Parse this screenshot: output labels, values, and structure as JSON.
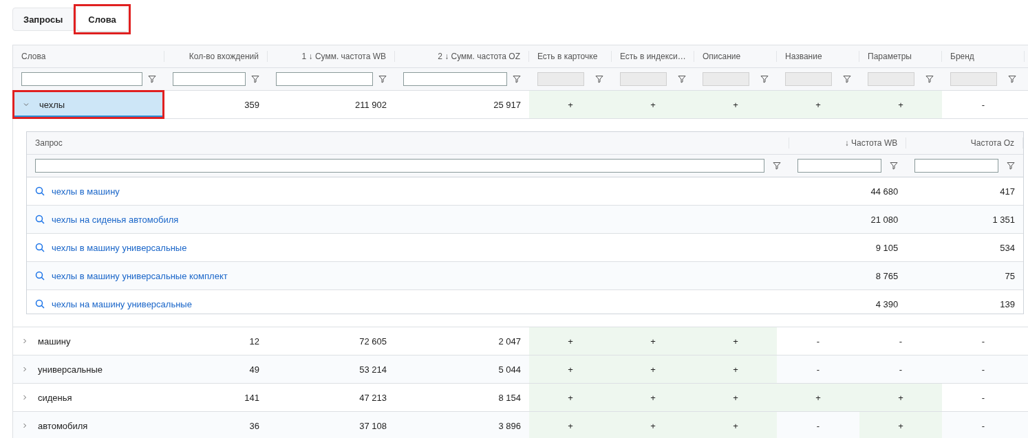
{
  "tabs": [
    {
      "label": "Запросы",
      "selected": false,
      "highlighted": false
    },
    {
      "label": "Слова",
      "selected": true,
      "highlighted": true
    }
  ],
  "table": {
    "columns": [
      {
        "label": "Слова",
        "filter_disabled": false
      },
      {
        "label": "Кол-во вхождений",
        "filter_disabled": false
      },
      {
        "label": "1 ↓ Сумм. частота WB",
        "filter_disabled": false
      },
      {
        "label": "2 ↓ Сумм. частота OZ",
        "filter_disabled": false
      },
      {
        "label": "Есть в карточке",
        "filter_disabled": true
      },
      {
        "label": "Есть в индекси…",
        "filter_disabled": true
      },
      {
        "label": "Описание",
        "filter_disabled": true
      },
      {
        "label": "Название",
        "filter_disabled": true
      },
      {
        "label": "Параметры",
        "filter_disabled": true
      },
      {
        "label": "Бренд",
        "filter_disabled": true
      }
    ],
    "rows": [
      {
        "word": "чехлы",
        "count": "359",
        "wb": "211 902",
        "oz": "25 917",
        "selected": true,
        "highlighted": true,
        "expanded": true,
        "flags": [
          {
            "text": "+",
            "present": true
          },
          {
            "text": "+",
            "present": true
          },
          {
            "text": "+",
            "present": true
          },
          {
            "text": "+",
            "present": true
          },
          {
            "text": "+",
            "present": true
          },
          {
            "text": "-",
            "present": false
          }
        ],
        "detail": {
          "columns": [
            {
              "label": "Запрос"
            },
            {
              "label": "↓ Частота WB"
            },
            {
              "label": "Частота Oz"
            }
          ],
          "rows": [
            {
              "query": "чехлы в машину",
              "wb": "44 680",
              "oz": "417"
            },
            {
              "query": "чехлы на сиденья автомобиля",
              "wb": "21 080",
              "oz": "1 351"
            },
            {
              "query": "чехлы в машину универсальные",
              "wb": "9 105",
              "oz": "534"
            },
            {
              "query": "чехлы в машину универсальные комплект",
              "wb": "8 765",
              "oz": "75"
            },
            {
              "query": "чехлы на машину универсальные",
              "wb": "4 390",
              "oz": "139"
            }
          ]
        }
      },
      {
        "word": "машину",
        "count": "12",
        "wb": "72 605",
        "oz": "2 047",
        "selected": false,
        "highlighted": false,
        "expanded": false,
        "flags": [
          {
            "text": "+",
            "present": true
          },
          {
            "text": "+",
            "present": true
          },
          {
            "text": "+",
            "present": true
          },
          {
            "text": "-",
            "present": false
          },
          {
            "text": "-",
            "present": false
          },
          {
            "text": "-",
            "present": false
          }
        ]
      },
      {
        "word": "универсальные",
        "count": "49",
        "wb": "53 214",
        "oz": "5 044",
        "selected": false,
        "highlighted": false,
        "expanded": false,
        "flags": [
          {
            "text": "+",
            "present": true
          },
          {
            "text": "+",
            "present": true
          },
          {
            "text": "+",
            "present": true
          },
          {
            "text": "-",
            "present": false
          },
          {
            "text": "-",
            "present": false
          },
          {
            "text": "-",
            "present": false
          }
        ]
      },
      {
        "word": "сиденья",
        "count": "141",
        "wb": "47 213",
        "oz": "8 154",
        "selected": false,
        "highlighted": false,
        "expanded": false,
        "flags": [
          {
            "text": "+",
            "present": true
          },
          {
            "text": "+",
            "present": true
          },
          {
            "text": "+",
            "present": true
          },
          {
            "text": "+",
            "present": true
          },
          {
            "text": "+",
            "present": true
          },
          {
            "text": "-",
            "present": false
          }
        ]
      },
      {
        "word": "автомобиля",
        "count": "36",
        "wb": "37 108",
        "oz": "3 896",
        "selected": false,
        "highlighted": false,
        "expanded": false,
        "flags": [
          {
            "text": "+",
            "present": true
          },
          {
            "text": "+",
            "present": true
          },
          {
            "text": "+",
            "present": true
          },
          {
            "text": "-",
            "present": false
          },
          {
            "text": "+",
            "present": true
          },
          {
            "text": "-",
            "present": false
          }
        ]
      }
    ]
  }
}
